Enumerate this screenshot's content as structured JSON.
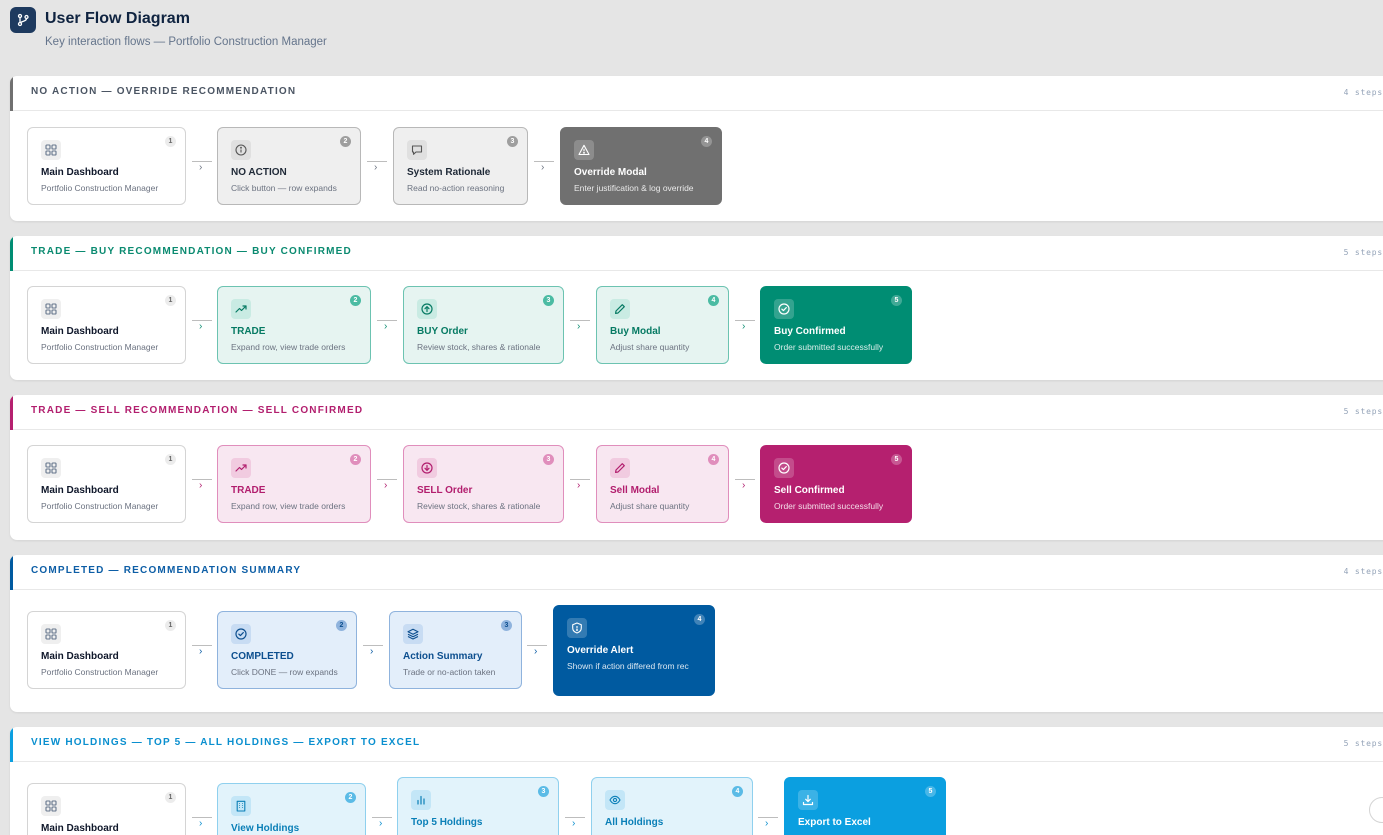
{
  "header": {
    "title": "User Flow Diagram",
    "subtitle": "Key interaction flows — Portfolio Construction Manager",
    "icon": "branch-icon"
  },
  "colors": {
    "gray": "#707070",
    "green": "#008d73",
    "pink": "#b5206f",
    "blue": "#005aa0",
    "cyan": "#0b9fe0"
  },
  "flows": [
    {
      "title": "NO ACTION — OVERRIDE RECOMMENDATION",
      "count": "4 steps",
      "steps": [
        {
          "num": "1",
          "label": "Main Dashboard",
          "desc": "Portfolio Construction Manager",
          "icon": "grid-icon"
        },
        {
          "num": "2",
          "label": "NO ACTION",
          "desc": "Click button — row expands",
          "icon": "info-icon"
        },
        {
          "num": "3",
          "label": "System Rationale",
          "desc": "Read no-action reasoning",
          "icon": "message-icon"
        },
        {
          "num": "4",
          "label": "Override Modal",
          "desc": "Enter justification & log override",
          "icon": "warning-icon"
        }
      ]
    },
    {
      "title": "TRADE — BUY RECOMMENDATION — BUY CONFIRMED",
      "count": "5 steps",
      "steps": [
        {
          "num": "1",
          "label": "Main Dashboard",
          "desc": "Portfolio Construction Manager",
          "icon": "grid-icon"
        },
        {
          "num": "2",
          "label": "TRADE",
          "desc": "Expand row, view trade orders",
          "icon": "trending-up-icon"
        },
        {
          "num": "3",
          "label": "BUY Order",
          "desc": "Review stock, shares & rationale",
          "icon": "arrow-up-circle-icon"
        },
        {
          "num": "4",
          "label": "Buy Modal",
          "desc": "Adjust share quantity",
          "icon": "pencil-icon"
        },
        {
          "num": "5",
          "label": "Buy Confirmed",
          "desc": "Order submitted successfully",
          "icon": "check-circle-icon"
        }
      ]
    },
    {
      "title": "TRADE — SELL RECOMMENDATION — SELL CONFIRMED",
      "count": "5 steps",
      "steps": [
        {
          "num": "1",
          "label": "Main Dashboard",
          "desc": "Portfolio Construction Manager",
          "icon": "grid-icon"
        },
        {
          "num": "2",
          "label": "TRADE",
          "desc": "Expand row, view trade orders",
          "icon": "trending-up-icon"
        },
        {
          "num": "3",
          "label": "SELL Order",
          "desc": "Review stock, shares & rationale",
          "icon": "arrow-down-circle-icon"
        },
        {
          "num": "4",
          "label": "Sell Modal",
          "desc": "Adjust share quantity",
          "icon": "pencil-icon"
        },
        {
          "num": "5",
          "label": "Sell Confirmed",
          "desc": "Order submitted successfully",
          "icon": "check-circle-icon"
        }
      ]
    },
    {
      "title": "COMPLETED — RECOMMENDATION SUMMARY",
      "count": "4 steps",
      "steps": [
        {
          "num": "1",
          "label": "Main Dashboard",
          "desc": "Portfolio Construction Manager",
          "icon": "grid-icon"
        },
        {
          "num": "2",
          "label": "COMPLETED",
          "desc": "Click DONE — row expands",
          "icon": "check-circle-icon"
        },
        {
          "num": "3",
          "label": "Action Summary",
          "desc": "Trade or no-action taken",
          "icon": "layers-icon"
        },
        {
          "num": "4",
          "label": "Override Alert",
          "desc": "Shown if action differed from rec",
          "icon": "shield-icon"
        }
      ]
    },
    {
      "title": "VIEW HOLDINGS — TOP 5 — ALL HOLDINGS — EXPORT TO EXCEL",
      "count": "5 steps",
      "steps": [
        {
          "num": "1",
          "label": "Main Dashboard",
          "desc": "",
          "icon": "grid-icon"
        },
        {
          "num": "2",
          "label": "View Holdings",
          "desc": "",
          "icon": "building-icon"
        },
        {
          "num": "3",
          "label": "Top 5 Holdings",
          "desc": "",
          "icon": "bar-chart-icon"
        },
        {
          "num": "4",
          "label": "All Holdings",
          "desc": "",
          "icon": "eye-icon"
        },
        {
          "num": "5",
          "label": "Export to Excel",
          "desc": "",
          "icon": "download-icon"
        }
      ]
    }
  ]
}
